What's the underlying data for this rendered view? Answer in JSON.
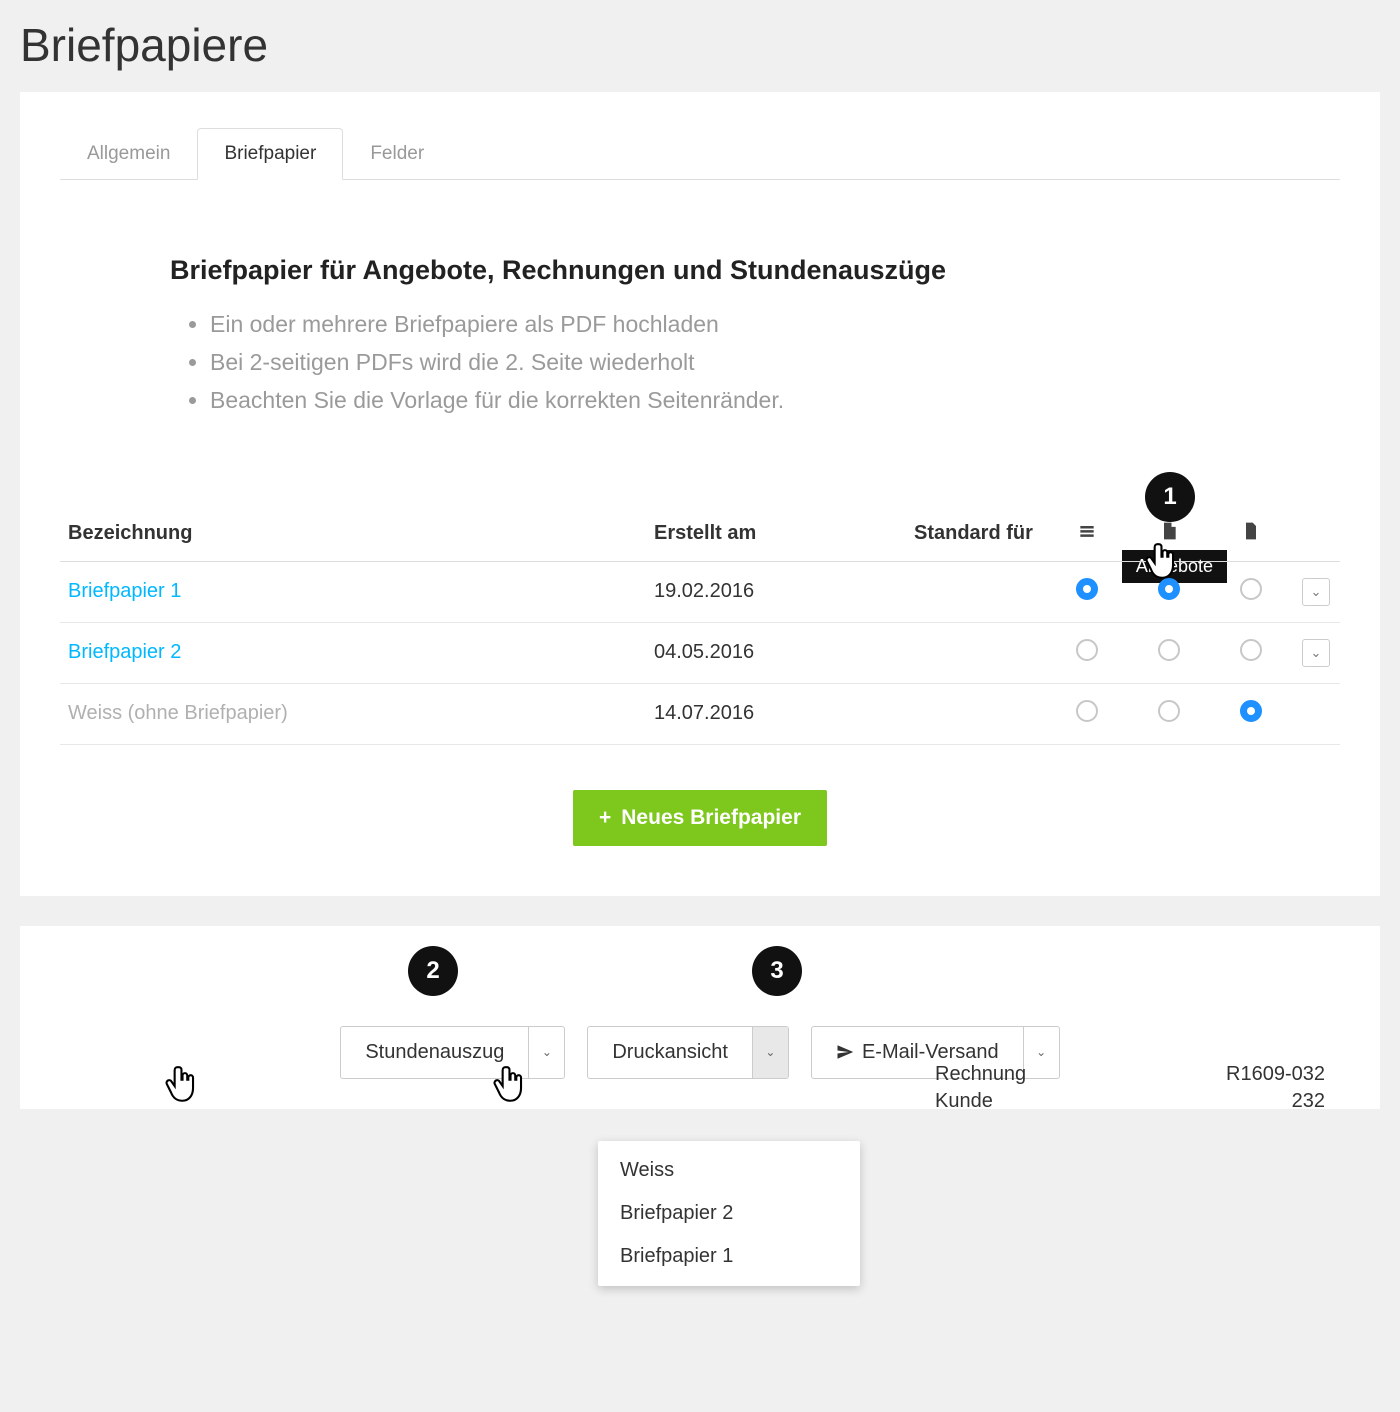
{
  "page": {
    "title": "Briefpapiere"
  },
  "tabs": [
    {
      "label": "Allgemein"
    },
    {
      "label": "Briefpapier"
    },
    {
      "label": "Felder"
    }
  ],
  "intro": {
    "heading": "Briefpapier für Angebote, Rechnungen und Stundenauszüge",
    "bullets": [
      "Ein oder mehrere Briefpapiere als PDF hochladen",
      "Bei 2-seitigen PDFs wird die 2. Seite wiederholt"
    ],
    "bullet3_pre": "Beachten Sie die ",
    "bullet3_link": "Vorlage",
    "bullet3_post": " für die korrekten Seitenränder."
  },
  "tooltip": "Angebote",
  "table": {
    "headers": {
      "name": "Bezeichnung",
      "created": "Erstellt am",
      "standard": "Standard für"
    },
    "icon_cols": [
      "stack-icon",
      "offer-icon",
      "file-icon"
    ],
    "rows": [
      {
        "name": "Briefpapier 1",
        "created": "19.02.2016",
        "radios": [
          true,
          true,
          false
        ],
        "link": true,
        "action": true
      },
      {
        "name": "Briefpapier 2",
        "created": "04.05.2016",
        "radios": [
          false,
          false,
          false
        ],
        "link": true,
        "action": true
      },
      {
        "name": "Weiss (ohne Briefpapier)",
        "created": "14.07.2016",
        "radios": [
          false,
          false,
          true
        ],
        "link": false,
        "action": false
      }
    ]
  },
  "new_button": "Neues Briefpapier",
  "annot": {
    "b1": "1",
    "b2": "2",
    "b3": "3"
  },
  "bottom": {
    "buttons": [
      {
        "label": "Stundenauszug",
        "hasIcon": false
      },
      {
        "label": "Druckansicht",
        "hasIcon": false
      },
      {
        "label": "E-Mail-Versand",
        "hasIcon": true
      }
    ],
    "dropdown": [
      "Weiss",
      "Briefpapier 2",
      "Briefpapier 1"
    ],
    "info": [
      {
        "k": "Rechnung",
        "v": "R1609-032"
      },
      {
        "k": "Kunde",
        "v": "232"
      }
    ]
  }
}
